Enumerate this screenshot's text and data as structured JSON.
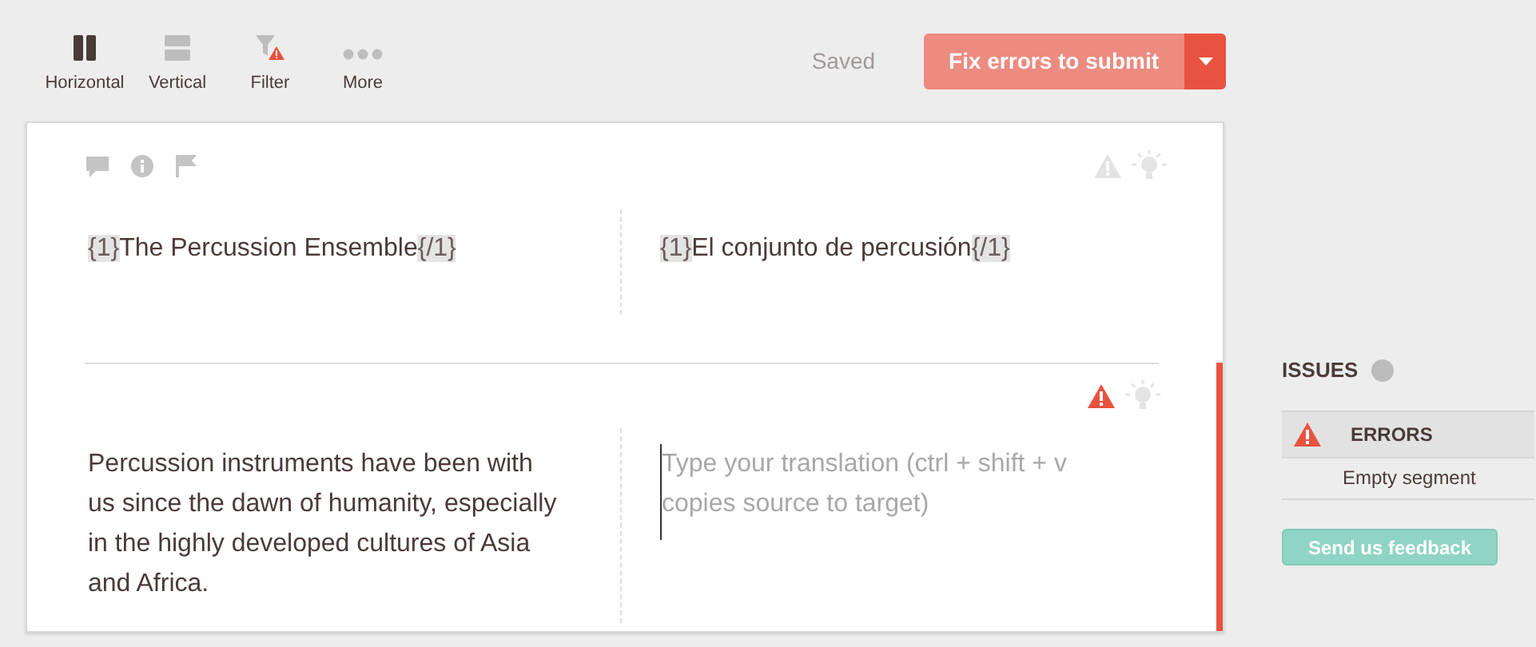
{
  "toolbar": [
    {
      "kind": "horizontal",
      "label": "Horizontal",
      "selected": true
    },
    {
      "kind": "vertical",
      "label": "Vertical",
      "selected": false
    },
    {
      "kind": "filter",
      "label": "Filter",
      "selected": false
    },
    {
      "kind": "more",
      "label": "More",
      "selected": false
    }
  ],
  "save_status": "Saved",
  "submit_button": {
    "label": "Fix errors to submit",
    "disabled": true
  },
  "segments": [
    {
      "has_error": false,
      "source": [
        {
          "kind": "tag",
          "text": "{1}"
        },
        {
          "kind": "text",
          "text": "The Percussion Ensemble"
        },
        {
          "kind": "tag",
          "text": "{/1}"
        }
      ],
      "target": [
        {
          "kind": "tag",
          "text": "{1}"
        },
        {
          "kind": "text",
          "text": "El conjunto de percusión"
        },
        {
          "kind": "tag",
          "text": "{/1}"
        }
      ]
    },
    {
      "has_error": true,
      "source": [
        {
          "kind": "text",
          "text": " Percussion instruments have been with us since the dawn of humanity, especially in the highly developed cultures of Asia and Africa."
        }
      ],
      "placeholder": "Type your translation (ctrl + shift + v copies source to target)"
    }
  ],
  "issues": {
    "title": "ISSUES",
    "groups": [
      {
        "title": "ERRORS",
        "items": [
          "Empty segment"
        ]
      }
    ],
    "feedback_button": "Send us feedback"
  }
}
